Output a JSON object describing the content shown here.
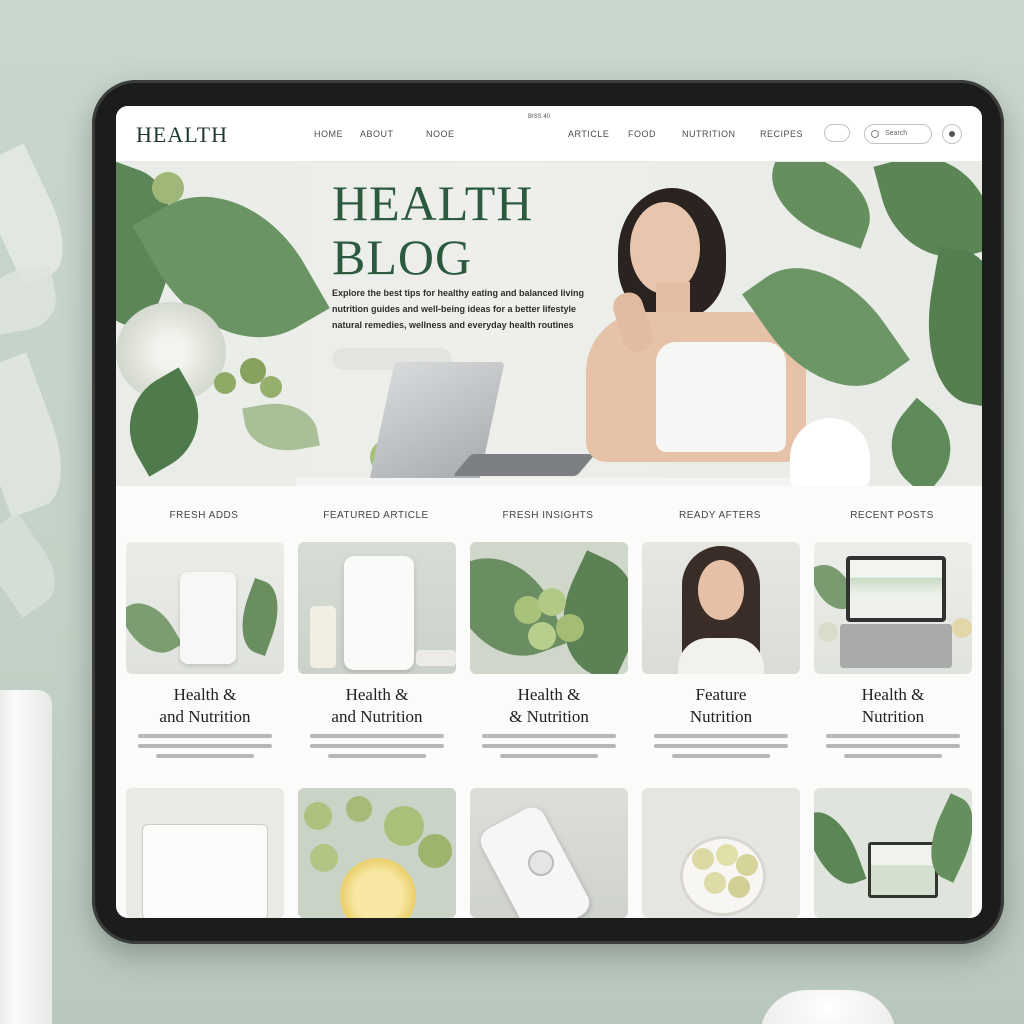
{
  "brand": "HEALTH",
  "nav": {
    "left_links": [
      "HOME",
      "ABOUT",
      "NOOE"
    ],
    "right_links": [
      "ARTICLE",
      "FOOD",
      "NUTRITION",
      "RECIPES"
    ],
    "notch_text": "BISS 40",
    "search_placeholder": "Search"
  },
  "hero": {
    "title_line1": "HEALTH",
    "title_line2": "BLOG",
    "text_lines": [
      "Explore the best tips for healthy eating and balanced living",
      "nutrition guides and well-being ideas for a better lifestyle",
      "natural remedies, wellness and everyday health routines"
    ]
  },
  "sections": [
    "FRESH ADDS",
    "FEATURED ARTICLE",
    "FRESH INSIGHTS",
    "READY AFTERS",
    "RECENT POSTS"
  ],
  "cards": [
    {
      "title_line1": "Health &",
      "title_line2": "and Nutrition"
    },
    {
      "title_line1": "Health &",
      "title_line2": "and Nutrition"
    },
    {
      "title_line1": "Health &",
      "title_line2": "& Nutrition"
    },
    {
      "title_line1": "Feature",
      "title_line2": "Nutrition"
    },
    {
      "title_line1": "Health &",
      "title_line2": "Nutrition"
    }
  ],
  "colors": {
    "accent_green": "#2b5a3e",
    "leaf_green": "#5f8a5c",
    "background": "#c7d4c9"
  }
}
